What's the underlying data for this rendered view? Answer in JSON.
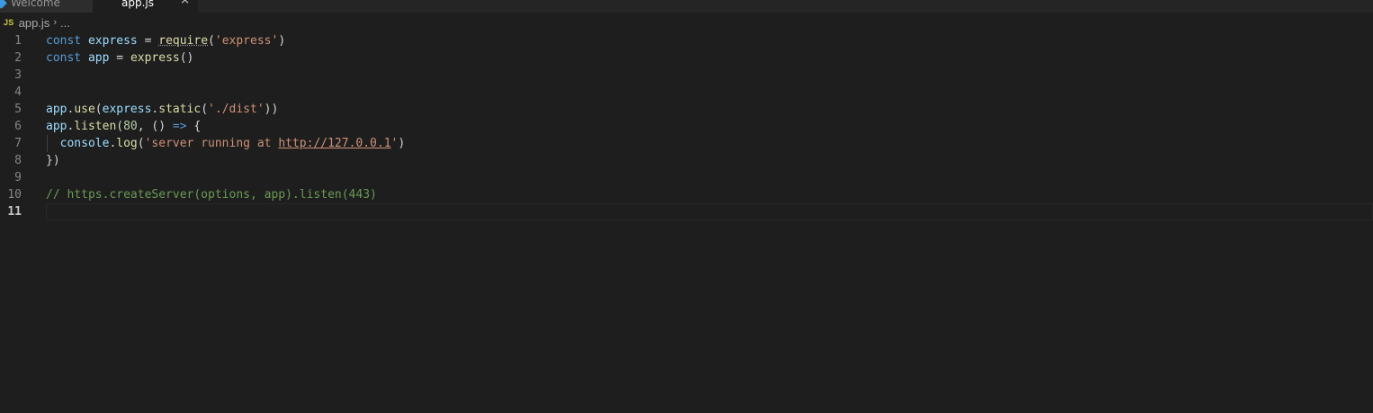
{
  "tabs": [
    {
      "label": "Welcome",
      "active": false
    },
    {
      "label": "app.js",
      "active": true,
      "close_glyph": "×"
    }
  ],
  "breadcrumb": {
    "badge": "JS",
    "file": "app.js",
    "separator": "›",
    "rest": "..."
  },
  "editor": {
    "current_line": 11,
    "lines": [
      {
        "num": "1",
        "tokens": [
          {
            "t": "const",
            "c": "kw"
          },
          {
            "t": " ",
            "c": "punc"
          },
          {
            "t": "express",
            "c": "var"
          },
          {
            "t": " = ",
            "c": "punc"
          },
          {
            "t": "require",
            "c": "require"
          },
          {
            "t": "(",
            "c": "punc"
          },
          {
            "t": "'express'",
            "c": "str"
          },
          {
            "t": ")",
            "c": "punc"
          }
        ]
      },
      {
        "num": "2",
        "tokens": [
          {
            "t": "const",
            "c": "kw"
          },
          {
            "t": " ",
            "c": "punc"
          },
          {
            "t": "app",
            "c": "var"
          },
          {
            "t": " = ",
            "c": "punc"
          },
          {
            "t": "express",
            "c": "fn"
          },
          {
            "t": "()",
            "c": "punc"
          }
        ]
      },
      {
        "num": "3",
        "tokens": []
      },
      {
        "num": "4",
        "tokens": []
      },
      {
        "num": "5",
        "tokens": [
          {
            "t": "app",
            "c": "var"
          },
          {
            "t": ".",
            "c": "punc"
          },
          {
            "t": "use",
            "c": "fn"
          },
          {
            "t": "(",
            "c": "punc"
          },
          {
            "t": "express",
            "c": "var"
          },
          {
            "t": ".",
            "c": "punc"
          },
          {
            "t": "static",
            "c": "fn"
          },
          {
            "t": "(",
            "c": "punc"
          },
          {
            "t": "'./dist'",
            "c": "str"
          },
          {
            "t": "))",
            "c": "punc"
          }
        ]
      },
      {
        "num": "6",
        "tokens": [
          {
            "t": "app",
            "c": "var"
          },
          {
            "t": ".",
            "c": "punc"
          },
          {
            "t": "listen",
            "c": "fn"
          },
          {
            "t": "(",
            "c": "punc"
          },
          {
            "t": "80",
            "c": "num"
          },
          {
            "t": ", () ",
            "c": "punc"
          },
          {
            "t": "=>",
            "c": "kw"
          },
          {
            "t": " {",
            "c": "punc"
          }
        ]
      },
      {
        "num": "7",
        "indent": true,
        "tokens": [
          {
            "t": "  ",
            "c": "punc"
          },
          {
            "t": "console",
            "c": "var"
          },
          {
            "t": ".",
            "c": "punc"
          },
          {
            "t": "log",
            "c": "fn"
          },
          {
            "t": "(",
            "c": "punc"
          },
          {
            "t": "'server running at ",
            "c": "str"
          },
          {
            "t": "http://127.0.0.1",
            "c": "link"
          },
          {
            "t": "'",
            "c": "str"
          },
          {
            "t": ")",
            "c": "punc"
          }
        ]
      },
      {
        "num": "8",
        "tokens": [
          {
            "t": "})",
            "c": "punc"
          }
        ]
      },
      {
        "num": "9",
        "tokens": []
      },
      {
        "num": "10",
        "tokens": [
          {
            "t": "// https.createServer(options, app).listen(443)",
            "c": "cmt"
          }
        ]
      },
      {
        "num": "11",
        "tokens": []
      }
    ]
  },
  "colors": {
    "background": "#1e1e1e",
    "keyword": "#569cd6",
    "variable": "#9cdcfe",
    "function": "#dcdcaa",
    "string": "#ce9178",
    "number": "#b5cea8",
    "comment": "#6a9955",
    "js_badge": "#cbcb41"
  }
}
